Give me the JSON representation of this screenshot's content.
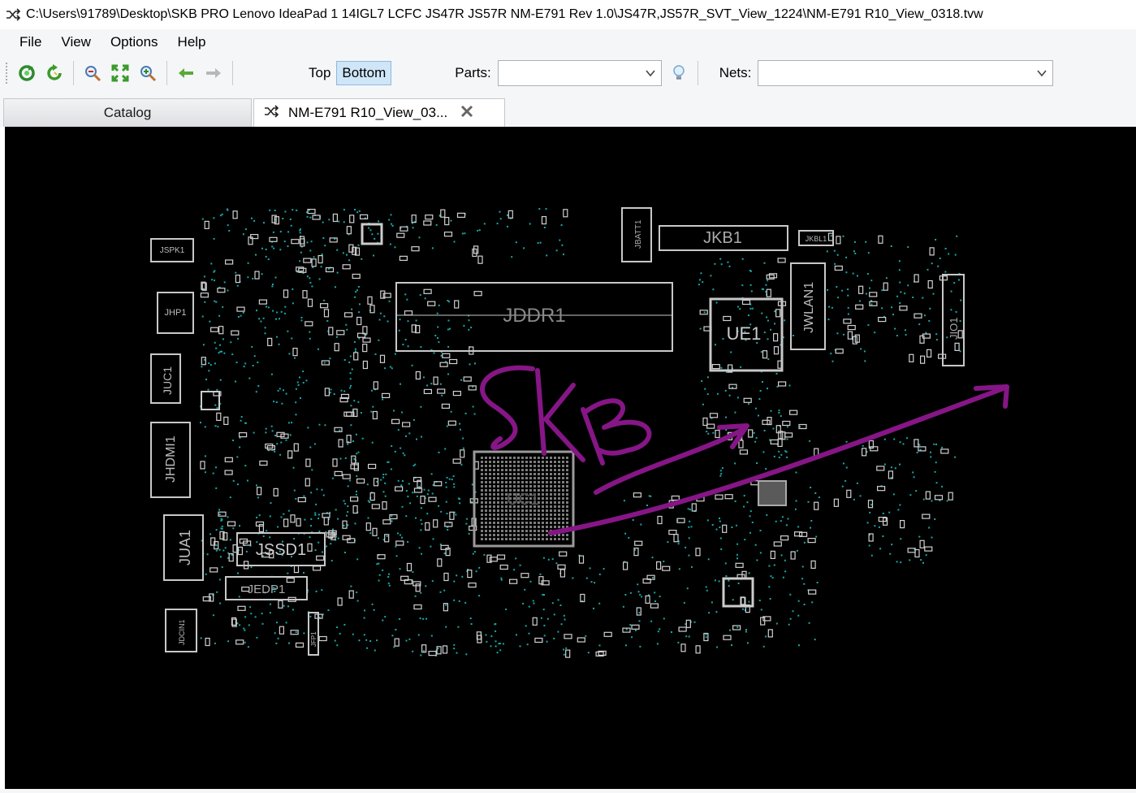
{
  "window": {
    "title": "C:\\Users\\91789\\Desktop\\SKB PRO Lenovo IdeaPad 1 14IGL7 LCFC JS47R JS57R NM-E791 Rev 1.0\\JS47R,JS57R_SVT_View_1224\\NM-E791 R10_View_0318.tvw"
  },
  "menu": [
    "File",
    "View",
    "Options",
    "Help"
  ],
  "toolbar": {
    "icons": [
      "refresh-icon",
      "rotate-icon",
      "zoom-out-icon",
      "fit-icon",
      "zoom-in-icon",
      "back-arrow-icon",
      "forward-arrow-icon"
    ],
    "top_label": "Top",
    "bottom_label": "Bottom",
    "active_side": "Bottom",
    "parts_label": "Parts:",
    "parts_value": "",
    "nets_label": "Nets:",
    "nets_value": "",
    "bulb_icon": "lightbulb-icon"
  },
  "tabs": {
    "catalog": "Catalog",
    "view": "NM-E791 R10_View_03..."
  },
  "board": {
    "background": "#000000",
    "outline_color": "#c8c8c8",
    "pad_color": "#1aa8a8",
    "annotation_color": "#8a1a8a",
    "components": {
      "jddr": "JDDR1",
      "jkb": "JKB1",
      "jkbl": "JKBL1",
      "jbatt": "JBATT1",
      "ue1": "UE1",
      "jwlan": "JWLAN1",
      "jio": "JIO1",
      "jspk": "JSPK1",
      "jhp": "JHP1",
      "juc": "JUC1",
      "jhdmi": "JHDMI1",
      "jua": "JUA1",
      "jssd": "JSSD1",
      "jedp": "JEDP1",
      "jdcin": "JDCIN1",
      "uc1": "UC1",
      "jfp": "JFP1"
    },
    "annotation_text": "SKB"
  }
}
